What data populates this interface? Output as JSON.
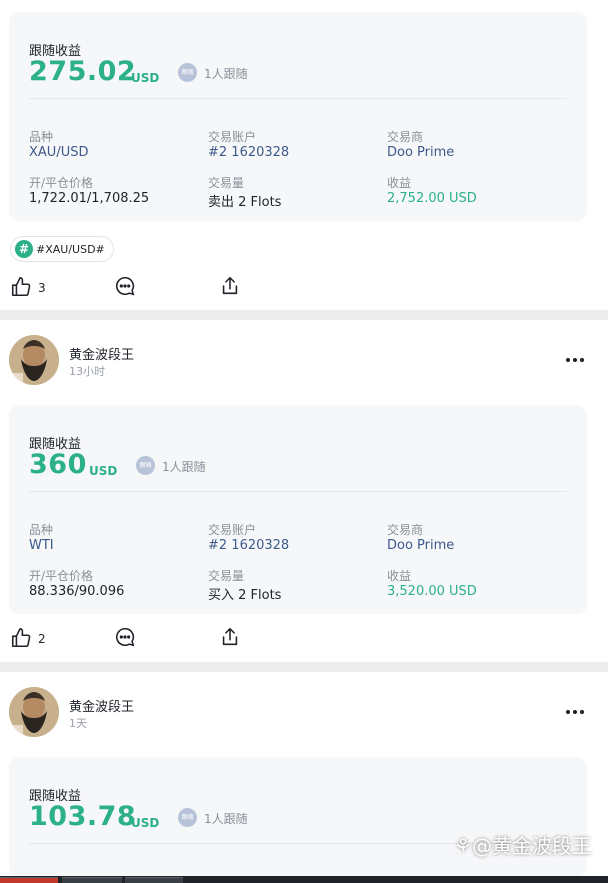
{
  "posts": [
    {
      "card": {
        "label": "跟随收益",
        "amount": "275.02",
        "unit": "USD",
        "follow_badge": "跟随",
        "follow_text": "1人跟随",
        "fields": {
          "symbol_key": "品种",
          "symbol_val": "XAU/USD",
          "account_key": "交易账户",
          "account_val": "#2 1620328",
          "broker_key": "交易商",
          "broker_val": "Doo Prime",
          "price_key": "开/平仓价格",
          "price_val": "1,722.01/1,708.25",
          "volume_key": "交易量",
          "volume_val": "卖出 2 Flots",
          "profit_key": "收益",
          "profit_val": "2,752.00 USD"
        }
      },
      "tag": "#XAU/USD#",
      "likes": "3"
    },
    {
      "author": "黄金波段王",
      "time": "13小时",
      "card": {
        "label": "跟随收益",
        "amount": "360",
        "unit": "USD",
        "follow_badge": "跟随",
        "follow_text": "1人跟随",
        "fields": {
          "symbol_key": "品种",
          "symbol_val": "WTI",
          "account_key": "交易账户",
          "account_val": "#2 1620328",
          "broker_key": "交易商",
          "broker_val": "Doo Prime",
          "price_key": "开/平仓价格",
          "price_val": "88.336/90.096",
          "volume_key": "交易量",
          "volume_val": "买入 2 Flots",
          "profit_key": "收益",
          "profit_val": "3,520.00 USD"
        }
      },
      "likes": "2"
    },
    {
      "author": "黄金波段王",
      "time": "1天",
      "card": {
        "label": "跟随收益",
        "amount": "103.78",
        "unit": "USD",
        "follow_badge": "跟随",
        "follow_text": "1人跟随"
      }
    }
  ],
  "watermark": "@黄金波段王",
  "colors": {
    "accent_green": "#2bb08a",
    "link_blue": "#3d5a8a",
    "card_bg": "#f6f7f9"
  }
}
